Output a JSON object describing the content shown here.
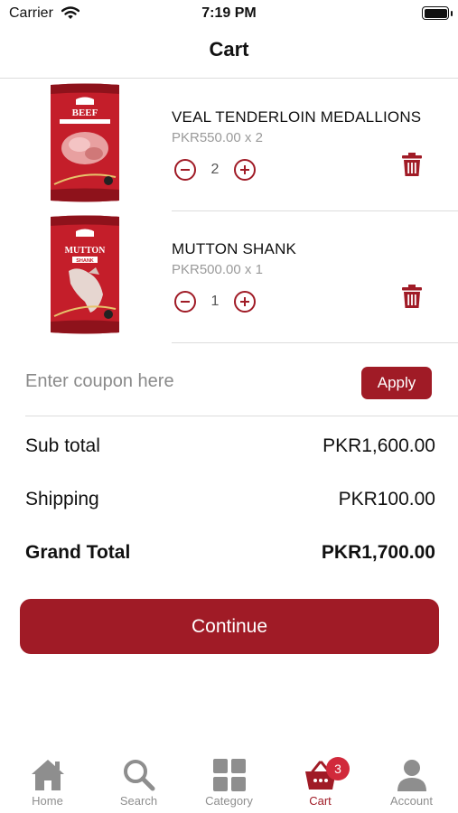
{
  "status_bar": {
    "carrier": "Carrier",
    "time": "7:19 PM"
  },
  "nav": {
    "title": "Cart"
  },
  "items": [
    {
      "name": "VEAL TENDERLOIN MEDALLIONS",
      "price": "PKR550.00",
      "multiplier": "x 2",
      "quantity": "2",
      "package_brand": "BEEF",
      "package_sub": "VEAL TENDERLOIN MEDALLIONS"
    },
    {
      "name": "MUTTON SHANK",
      "price": "PKR500.00",
      "multiplier": "x 1",
      "quantity": "1",
      "package_brand": "MUTTON",
      "package_sub": "SHANK"
    }
  ],
  "coupon": {
    "placeholder": "Enter coupon here",
    "value": "",
    "apply_label": "Apply"
  },
  "totals": {
    "subtotal_label": "Sub total",
    "subtotal_value": "PKR1,600.00",
    "shipping_label": "Shipping",
    "shipping_value": "PKR100.00",
    "grand_label": "Grand Total",
    "grand_value": "PKR1,700.00"
  },
  "continue_label": "Continue",
  "tabs": [
    {
      "label": "Home",
      "icon": "home-icon"
    },
    {
      "label": "Search",
      "icon": "search-icon"
    },
    {
      "label": "Category",
      "icon": "grid-icon"
    },
    {
      "label": "Cart",
      "icon": "basket-icon",
      "active": true,
      "badge": "3"
    },
    {
      "label": "Account",
      "icon": "person-icon"
    }
  ],
  "colors": {
    "accent": "#a01b26",
    "badge": "#d1293b",
    "inactive": "#8e8e8e",
    "divider": "#dcdcdc"
  }
}
